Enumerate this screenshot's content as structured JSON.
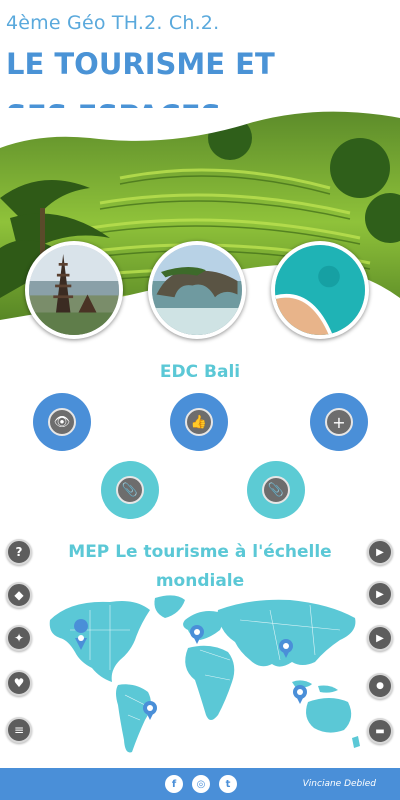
{
  "header": {
    "subtitle": "4ème Géo TH.2. Ch.2.",
    "title_line1": "LE TOURISME ET",
    "title_line2": "SES ESPACES"
  },
  "section1": {
    "title": "EDC Bali",
    "buttons": [
      {
        "icon": "eye-icon",
        "glyph": "👁"
      },
      {
        "icon": "thumbs-up-icon",
        "glyph": "👍"
      },
      {
        "icon": "plus-icon",
        "glyph": "+"
      },
      {
        "icon": "paperclip-icon",
        "glyph": "📎"
      },
      {
        "icon": "paperclip-icon",
        "glyph": "📎"
      }
    ]
  },
  "section2": {
    "title_line1": "MEP Le tourisme à l'échelle",
    "title_line2": "mondiale"
  },
  "left_sidebar": [
    {
      "icon": "question-icon",
      "glyph": "?"
    },
    {
      "icon": "tag-icon",
      "glyph": "◆"
    },
    {
      "icon": "pin-icon",
      "glyph": "✦"
    },
    {
      "icon": "heart-icon",
      "glyph": "♥"
    },
    {
      "icon": "menu-icon",
      "glyph": "≡"
    }
  ],
  "right_sidebar": [
    {
      "icon": "play-icon",
      "glyph": "▶"
    },
    {
      "icon": "play-icon",
      "glyph": "▶"
    },
    {
      "icon": "play-icon",
      "glyph": "▶"
    },
    {
      "icon": "location-icon",
      "glyph": "●"
    },
    {
      "icon": "folder-icon",
      "glyph": "▬"
    }
  ],
  "footer": {
    "social": [
      {
        "icon": "facebook-icon",
        "glyph": "f"
      },
      {
        "icon": "instagram-icon",
        "glyph": "◎"
      },
      {
        "icon": "twitter-icon",
        "glyph": "t"
      }
    ],
    "author": "Vinciane Debled"
  },
  "colors": {
    "primary": "#4a8fd8",
    "teal": "#5ccbd4",
    "title": "#4a93d6"
  }
}
